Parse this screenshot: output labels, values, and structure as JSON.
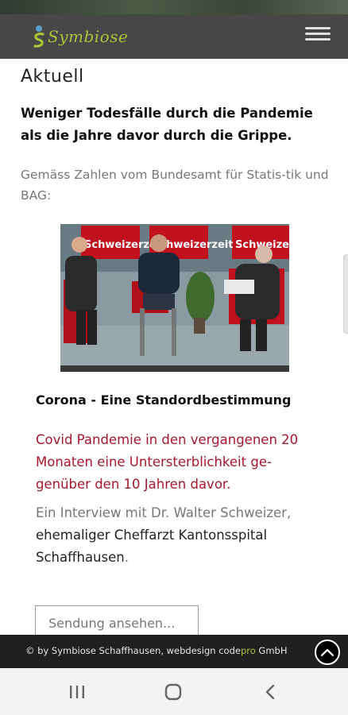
{
  "header": {
    "logo_text": "Symbiose",
    "menu_icon": "hamburger-menu-icon"
  },
  "main": {
    "title": "Aktuell",
    "lead": "Weniger Todesfälle durch die Pandemie als die Jahre davor durch die Grippe.",
    "intro": "Gemäss Zahlen vom Bundesamt für Statis-tik und BAG:"
  },
  "video_card": {
    "thumbnail_banner": "Schweizerzeit",
    "title": "Corona - Eine Standordbestimmung",
    "highlight": "Covid Pandemie in den vergangenen 20 Monaten eine Untersterblichkeit ge-genüber den 10 Jahren davor.",
    "desc_part1": "Ein Interview mit Dr. Walter Schweizer,",
    "desc_part2": "ehemaliger Cheffarzt Kantonsspital Schaffhausen",
    "desc_part3": ".",
    "watch_button": "Sendung ansehen..."
  },
  "footer": {
    "text_prefix": "© by Symbiose Schaffhausen, webdesign code",
    "text_accent": "pro",
    "text_suffix": " GmbH"
  },
  "colors": {
    "header_bg": "#474747",
    "brand_green": "#a8c43a",
    "highlight_red": "#a8172d",
    "footer_bg": "#1f1f1f"
  }
}
